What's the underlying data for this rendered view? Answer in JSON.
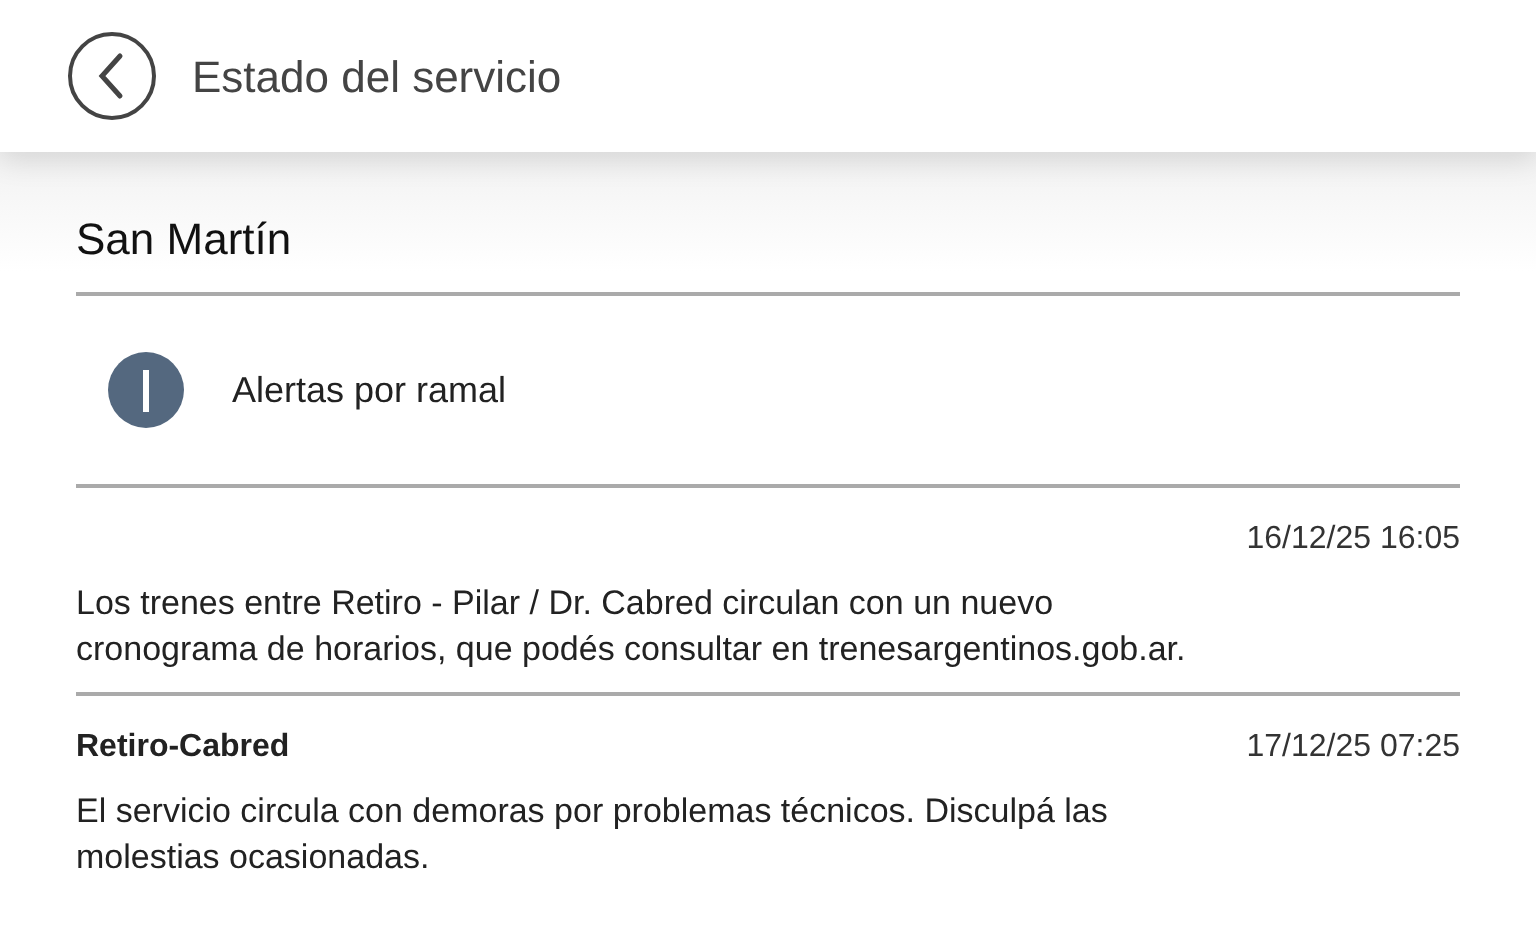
{
  "header": {
    "title": "Estado del servicio"
  },
  "line": {
    "name": "San Martín"
  },
  "info": {
    "label": "Alertas por ramal"
  },
  "alerts": [
    {
      "time": "16/12/25 16:05",
      "message": "Los trenes entre Retiro - Pilar / Dr. Cabred circulan con un nuevo cronograma de horarios, que podés consultar en trenesargentinos.gob.ar."
    },
    {
      "branch": "Retiro-Cabred",
      "time": "17/12/25 07:25",
      "message": "El servicio circula con demoras por problemas técnicos. Disculpá las molestias ocasionadas."
    }
  ]
}
